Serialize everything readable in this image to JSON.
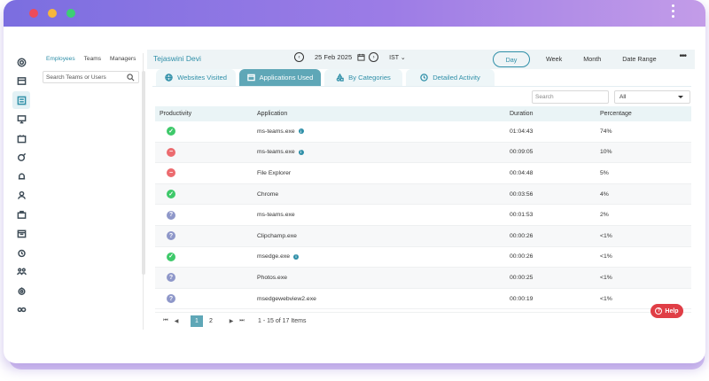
{
  "window": {
    "accent": "#2f8fa8",
    "titlebar_gradient": [
      "#7b6ee0",
      "#c39ce8"
    ]
  },
  "rail": {
    "icons": [
      "dashboard-icon",
      "screens-icon",
      "reports-icon",
      "monitor-icon",
      "calendar-icon",
      "alerts-icon",
      "notifications-icon",
      "user-icon",
      "briefcase-icon",
      "schedule-icon",
      "alarm-icon",
      "team-icon",
      "settings-icon",
      "toggle-icon"
    ],
    "active_index": 2
  },
  "employees": {
    "tabs": [
      "Employees",
      "Teams",
      "Managers"
    ],
    "search_placeholder": "Search Teams or Users"
  },
  "topbar": {
    "user_name": "Tejaswini Devi",
    "date": "25 Feb 2025",
    "timezone": "IST",
    "ranges": [
      "Day",
      "Week",
      "Month",
      "Date Range"
    ],
    "active_range": "Day",
    "more": "•••"
  },
  "tabs": [
    {
      "label": "Websites Visited",
      "icon": "globe-icon"
    },
    {
      "label": "Applications Used",
      "icon": "app-window-icon",
      "active": true
    },
    {
      "label": "By Categories",
      "icon": "categories-icon"
    },
    {
      "label": "Detailed Activity",
      "icon": "clock-icon"
    }
  ],
  "filters": {
    "search_placeholder": "Search",
    "select_value": "All"
  },
  "table": {
    "headers": [
      "Productivity",
      "Application",
      "Duration",
      "Percentage"
    ],
    "rows": [
      {
        "status": "productive",
        "app": "ms-teams.exe",
        "info": true,
        "duration": "01:04:43",
        "percentage": "74%"
      },
      {
        "status": "unproductive",
        "app": "ms-teams.exe",
        "info": true,
        "duration": "00:09:05",
        "percentage": "10%"
      },
      {
        "status": "unproductive",
        "app": "File Explorer",
        "info": false,
        "duration": "00:04:48",
        "percentage": "5%"
      },
      {
        "status": "productive",
        "app": "Chrome",
        "info": false,
        "duration": "00:03:56",
        "percentage": "4%"
      },
      {
        "status": "neutral",
        "app": "ms-teams.exe",
        "info": false,
        "duration": "00:01:53",
        "percentage": "2%"
      },
      {
        "status": "neutral",
        "app": "Clipchamp.exe",
        "info": false,
        "duration": "00:00:26",
        "percentage": "<1%"
      },
      {
        "status": "productive",
        "app": "msedge.exe",
        "info": true,
        "duration": "00:00:26",
        "percentage": "<1%"
      },
      {
        "status": "neutral",
        "app": "Photos.exe",
        "info": false,
        "duration": "00:00:25",
        "percentage": "<1%"
      },
      {
        "status": "neutral",
        "app": "msedgewebview2.exe",
        "info": false,
        "duration": "00:00:19",
        "percentage": "<1%"
      }
    ]
  },
  "pagination": {
    "first": "⏮",
    "prev": "◀",
    "next": "▶",
    "last": "⏭",
    "pages": [
      "1",
      "2"
    ],
    "active_page": "1",
    "info": "1 - 15 of 17 Items"
  },
  "help_label": "Help",
  "status_colors": {
    "productive": "#3ec96a",
    "unproductive": "#ec6b6f",
    "neutral": "#8e97c9"
  }
}
